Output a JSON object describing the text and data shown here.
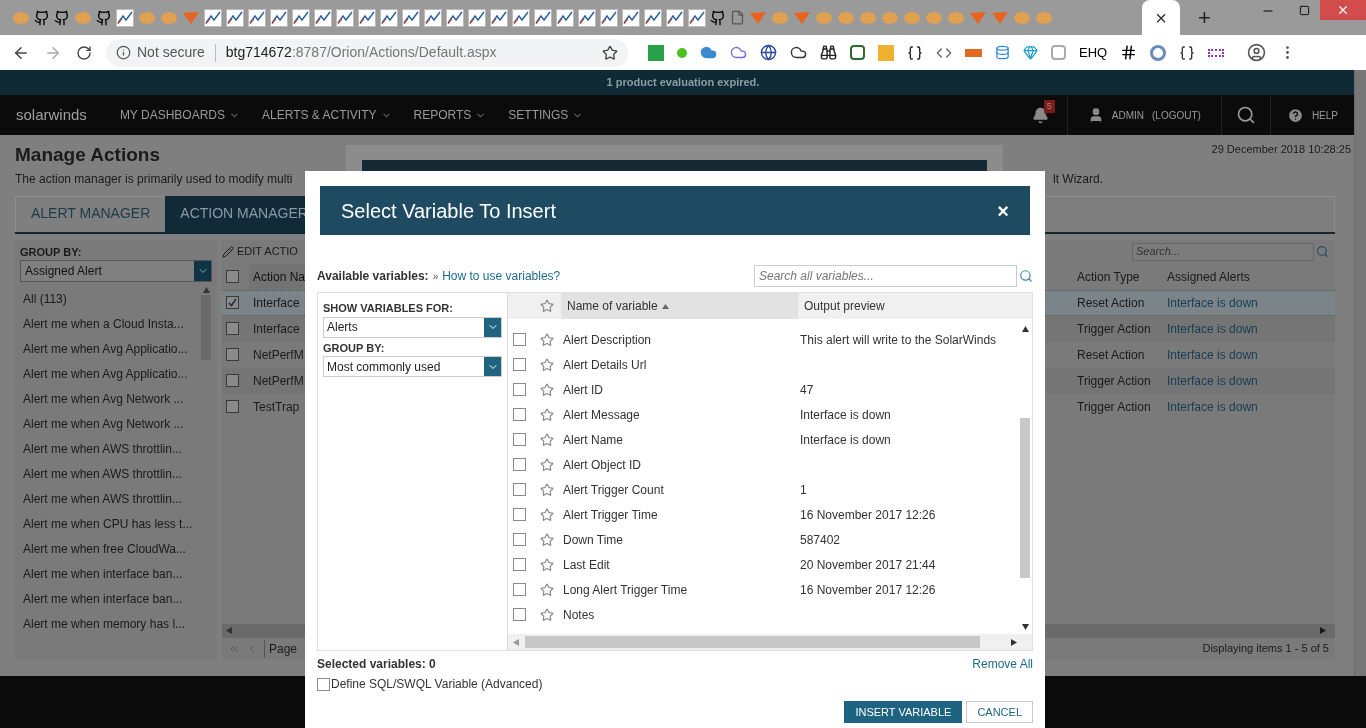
{
  "browser": {
    "close_tab": "×",
    "new_tab": "+",
    "security": "Not secure",
    "host": "btg714672",
    "path": ":8787/Orion/Actions/Default.aspx",
    "extension_label": "EHQ"
  },
  "banner": "1 product evaluation expired.",
  "nav": {
    "logo": "solarwinds",
    "menus": [
      "MY DASHBOARDS",
      "ALERTS & ACTIVITY",
      "REPORTS",
      "SETTINGS"
    ],
    "notification_count": "5",
    "user": "ADMIN",
    "logout": "(LOGOUT)",
    "help": "HELP"
  },
  "page": {
    "title": "Manage Actions",
    "description": "The action manager is primarily used to modify multi",
    "description_end": "lt Wizard.",
    "timestamp": "29 December 2018 10:28:25"
  },
  "tabs": [
    {
      "label": "ALERT MANAGER",
      "selected": false
    },
    {
      "label": "ACTION MANAGER",
      "selected": true
    }
  ],
  "group_panel": {
    "label": "GROUP BY:",
    "value": "Assigned Alert",
    "items": [
      "All (113)",
      "Alert me when a Cloud Insta...",
      "Alert me when Avg Applicatio...",
      "Alert me when Avg Applicatio...",
      "Alert me when Avg Network ...",
      "Alert me when Avg Network ...",
      "Alert me when AWS throttlin...",
      "Alert me when AWS throttlin...",
      "Alert me when AWS throttlin...",
      "Alert me when CPU has less t...",
      "Alert me when free CloudWa...",
      "Alert me when interface ban...",
      "Alert me when interface ban...",
      "Alert me when memory has l..."
    ]
  },
  "toolbar": {
    "edit": "EDIT ACTIO",
    "search_placeholder": "Search..."
  },
  "table": {
    "header_checked": false,
    "columns": [
      "Action Na",
      "Action Type",
      "Assigned Alerts"
    ],
    "rows": [
      {
        "name": "Interface",
        "type": "Reset Action",
        "alert": "Interface is down",
        "checked": true,
        "selected": true
      },
      {
        "name": "Interface",
        "type": "Trigger Action",
        "alert": "Interface is down",
        "checked": false,
        "selected": false
      },
      {
        "name": "NetPerfM",
        "type": "Reset Action",
        "alert": "Interface is down",
        "checked": false,
        "selected": false
      },
      {
        "name": "NetPerfM",
        "type": "Trigger Action",
        "alert": "Interface is down",
        "checked": false,
        "selected": false
      },
      {
        "name": "TestTrap",
        "type": "Trigger Action",
        "alert": "Interface is down",
        "checked": false,
        "selected": false
      }
    ]
  },
  "pager": {
    "page": "Page",
    "status": "Displaying items 1 - 5 of 5"
  },
  "dialog": {
    "title": "Select Variable To Insert",
    "close": "×",
    "available_label": "Available variables:",
    "link_marker": "»",
    "help_link": "How to use variables?",
    "search_placeholder": "Search all variables...",
    "show_for_label": "SHOW VARIABLES FOR:",
    "show_for_value": "Alerts",
    "group_by_label": "GROUP BY:",
    "group_by_value": "Most commonly used",
    "columns": [
      "Name of variable",
      "Output preview"
    ],
    "variables": [
      {
        "name": "Alert Description",
        "preview": "This alert will write to the SolarWinds",
        "checked": false
      },
      {
        "name": "Alert Details Url",
        "checked": false
      },
      {
        "name": "Alert ID",
        "preview": "47",
        "checked": false
      },
      {
        "name": "Alert Message",
        "preview": "Interface is down",
        "checked": false
      },
      {
        "name": "Alert Name",
        "preview": "Interface is down",
        "checked": false
      },
      {
        "name": "Alert Object ID",
        "checked": false
      },
      {
        "name": "Alert Trigger Count",
        "preview": "1",
        "checked": false
      },
      {
        "name": "Alert Trigger Time",
        "preview": "16 November 2017 12:26",
        "checked": false
      },
      {
        "name": "Down Time",
        "preview": "587402",
        "checked": false
      },
      {
        "name": "Last Edit",
        "preview": "20 November 2017 21:44",
        "checked": false
      },
      {
        "name": "Long Alert Trigger Time",
        "preview": "16 November 2017 12:26",
        "checked": false
      },
      {
        "name": "Notes",
        "checked": false
      }
    ],
    "selected_count": "Selected variables: 0",
    "remove_all": "Remove All",
    "sql_option": {
      "label": "Define SQL/SWQL Variable (Advanced)",
      "checked": false
    },
    "insert_button": "INSERT VARIABLE",
    "cancel_button": "CANCEL"
  }
}
